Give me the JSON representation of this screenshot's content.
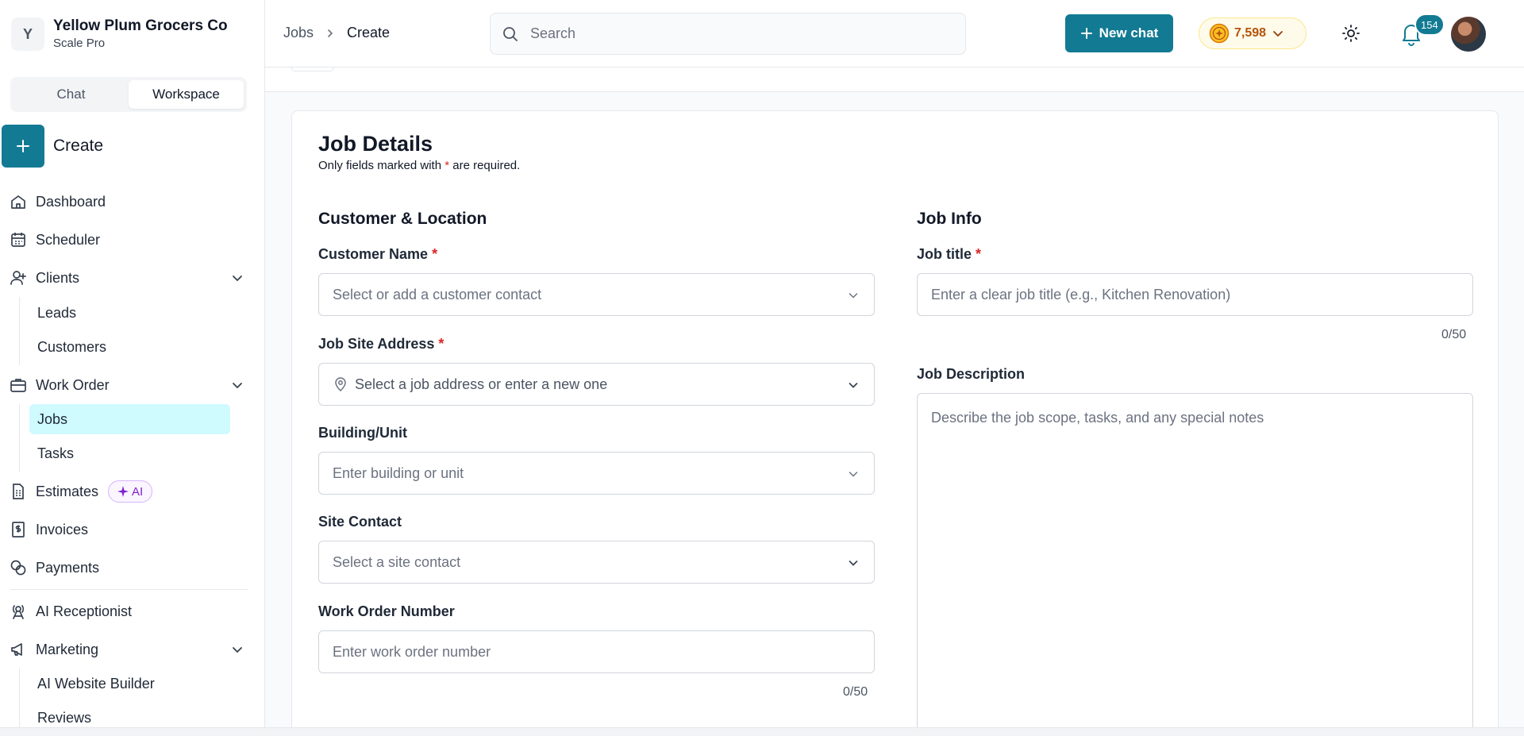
{
  "org": {
    "initial": "Y",
    "name": "Yellow Plum Grocers Co",
    "plan": "Scale Pro"
  },
  "mode_toggle": {
    "chat": "Chat",
    "workspace": "Workspace"
  },
  "create_label": "Create",
  "nav": {
    "dashboard": "Dashboard",
    "scheduler": "Scheduler",
    "clients": "Clients",
    "leads": "Leads",
    "customers": "Customers",
    "work_order": "Work Order",
    "jobs": "Jobs",
    "tasks": "Tasks",
    "estimates": "Estimates",
    "ai_badge": "AI",
    "invoices": "Invoices",
    "payments": "Payments",
    "ai_receptionist": "AI Receptionist",
    "marketing": "Marketing",
    "ai_website_builder": "AI Website Builder",
    "reviews": "Reviews"
  },
  "header": {
    "breadcrumb_parent": "Jobs",
    "breadcrumb_current": "Create",
    "search_placeholder": "Search",
    "new_chat": "New chat",
    "credits": "7,598",
    "notification_count": "154"
  },
  "form": {
    "title": "Job Details",
    "subtitle_before": "Only fields marked with ",
    "required_mark": "*",
    "subtitle_after": " are required.",
    "customer_location_title": "Customer & Location",
    "customer_name_label": "Customer Name",
    "customer_name_placeholder": "Select or add a customer contact",
    "job_site_label": "Job Site Address",
    "job_site_placeholder": "Select a job address or enter a new one",
    "building_label": "Building/Unit",
    "building_placeholder": "Enter building or unit",
    "site_contact_label": "Site Contact",
    "site_contact_placeholder": "Select a site contact",
    "work_order_label": "Work Order Number",
    "work_order_placeholder": "Enter work order number",
    "work_order_counter": "0/50",
    "job_info_title": "Job Info",
    "job_title_label": "Job title",
    "job_title_placeholder": "Enter a clear job title (e.g., Kitchen Renovation)",
    "job_title_counter": "0/50",
    "job_description_label": "Job Description",
    "job_description_placeholder": "Describe the job scope, tasks, and any special notes"
  },
  "colors": {
    "primary": "#127a93",
    "active_nav": "#cffafe",
    "required": "#dc2626",
    "ai_purple": "#7e22ce",
    "credits_amber": "#b45309"
  },
  "icons": [
    "plus-icon",
    "home-icon",
    "calendar-icon",
    "user-plus-icon",
    "chevron-down-icon",
    "briefcase-icon",
    "file-text-icon",
    "sparkles-icon",
    "dollar-icon",
    "coins-icon",
    "radio-tower-icon",
    "megaphone-icon",
    "search-icon",
    "chevron-right-icon",
    "coin-icon",
    "sun-icon",
    "bell-icon",
    "map-pin-icon"
  ]
}
